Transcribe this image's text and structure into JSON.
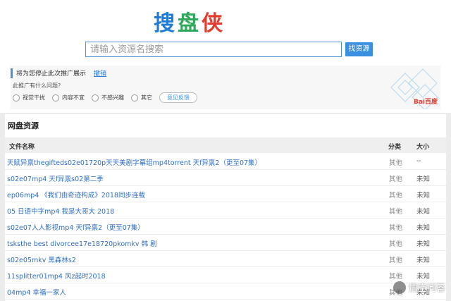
{
  "logo": {
    "c1": "搜",
    "c2": "盘",
    "c3": "侠"
  },
  "search": {
    "placeholder": "请输入资源名搜索",
    "button": "找资源"
  },
  "ad": {
    "question": "将为您停止此次推广展示",
    "cancel": "撤销",
    "why": "此推广有什么问题?",
    "options": [
      "视觉干扰",
      "内容不宜",
      "不感兴趣",
      "其它"
    ],
    "feedback": "意见反馈",
    "brand": "Bai百度"
  },
  "panel": {
    "title": "网盘资源",
    "headers": {
      "name": "文件名称",
      "category": "分类",
      "size": "大小"
    },
    "rows": [
      {
        "name": "天赋异禀thegifteds02e01720p天天美剧字幕组mp4torrent 天f异禀2（更至07集）",
        "category": "其他",
        "size": "--"
      },
      {
        "name": "s02e07mp4 天f异禀s02第二季",
        "category": "其他",
        "size": "未知"
      },
      {
        "name": "ep06mp4 《我们由奇迹构成》2018同步连载",
        "category": "其他",
        "size": "未知"
      },
      {
        "name": "05 日语中字mp4 我是大哥大 2018",
        "category": "其他",
        "size": "未知"
      },
      {
        "name": "s02e07人人影视mp4 天f异禀2（更至07集）",
        "category": "其他",
        "size": "未知"
      },
      {
        "name": "tsksthe best divorcee17e18720pkomkv 韩 剧",
        "category": "其他",
        "size": "未知"
      },
      {
        "name": "s02e05mkv 黑森林s2",
        "category": "其他",
        "size": "未知"
      },
      {
        "name": "11splitter01mp4 风z起时2018",
        "category": "其他",
        "size": "未知"
      },
      {
        "name": "04mp4 幸福一家人",
        "category": "其他",
        "size": "未知"
      }
    ]
  },
  "watermark": "悟空问答"
}
